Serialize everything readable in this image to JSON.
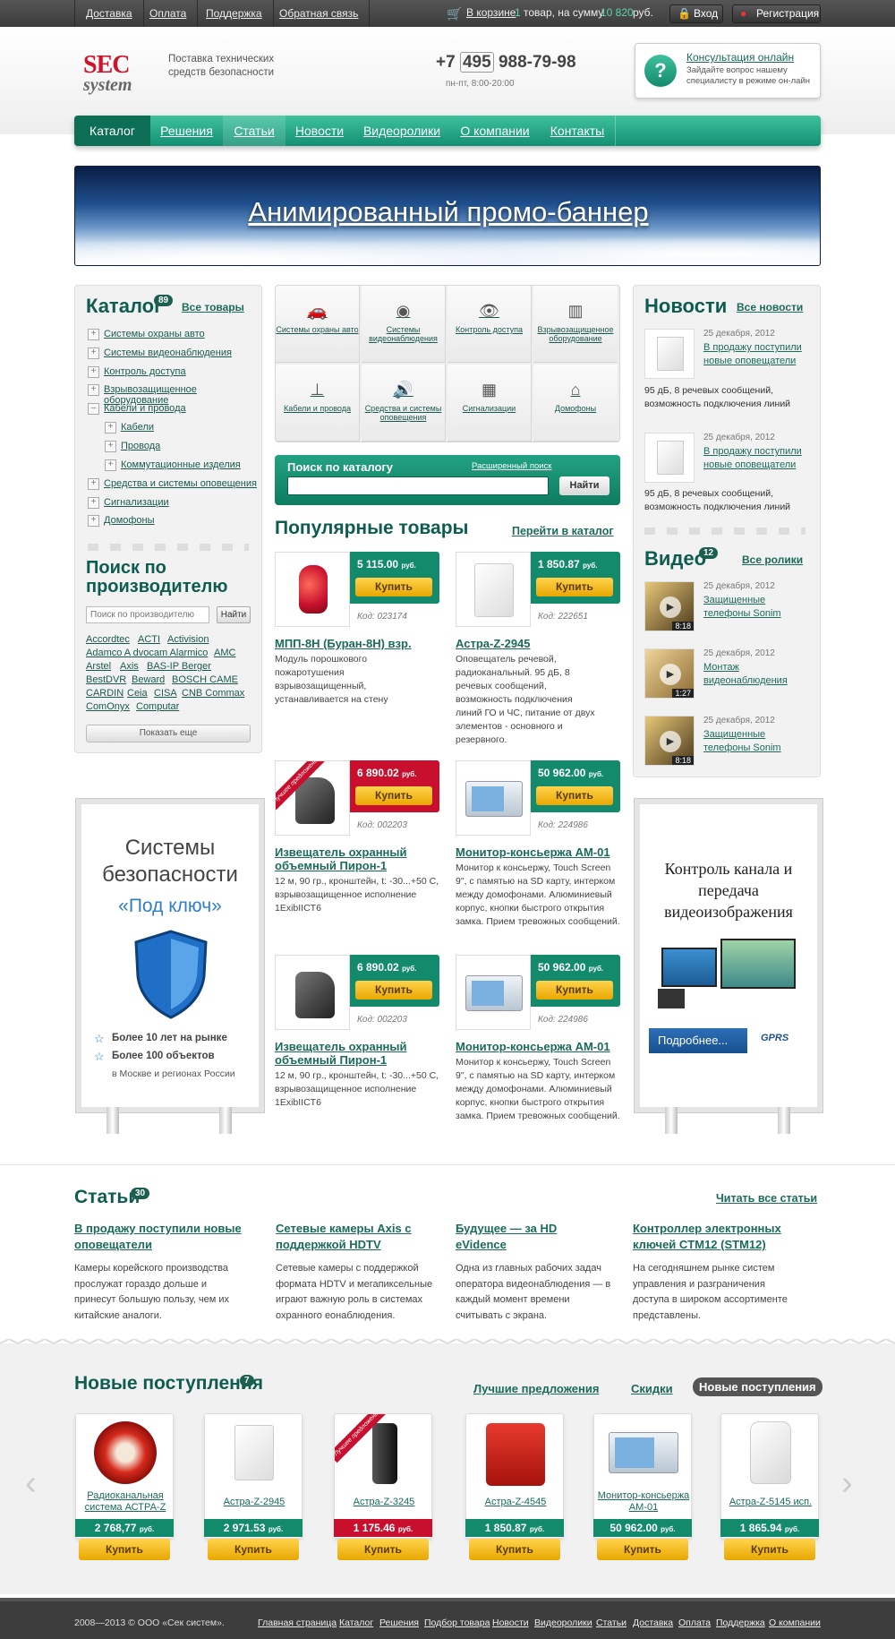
{
  "topbar": {
    "links": [
      "Доставка",
      "Оплата",
      "Поддержка",
      "Обратная связь"
    ],
    "cart_prefix": "В корзине",
    "cart_count": "1",
    "cart_mid": "товар, на сумму",
    "cart_sum": "10 820",
    "cart_currency": "руб.",
    "login": "Вход",
    "register": "Регистрация"
  },
  "header": {
    "logo_top": "SEC",
    "logo_bottom": "system",
    "tagline": "Поставка технических средств безопасности",
    "phone_prefix": "+7",
    "phone_code": "495",
    "phone_number": "988-79-98",
    "hours": "пн-пт, 8:00-20:00",
    "consult_title": "Консультация онлайн",
    "consult_text": "Зайдайте вопрос нашему специалисту в режиме он-лайн"
  },
  "nav": [
    "Каталог",
    "Решения",
    "Статьи",
    "Новости",
    "Видеоролики",
    "О компании",
    "Контакты"
  ],
  "banner": {
    "text": "Анимированный промо-баннер"
  },
  "catalog": {
    "title": "Каталог",
    "count": "89",
    "all": "Все товары",
    "items": [
      "Системы охраны авто",
      "Системы видеонаблюдения",
      "Контроль доступа",
      "Взрывозащищенное оборудование",
      "Кабели и провода",
      "Кабели",
      "Провода",
      "Коммутационные изделия",
      "Средства и системы оповещения",
      "Сигнализации",
      "Домофоны"
    ],
    "by_maker_title": "Поиск по производителю",
    "maker_placeholder": "Поиск по производителю",
    "maker_btn": "Найти",
    "brands": [
      "Accordtec",
      "ACTI",
      "Activision",
      "Adamco A dvocam Alarmico",
      "AMC",
      "Arstel",
      "Axis",
      "BAS-IP Berger",
      "BestDVR",
      "Beward",
      "BOSCH CAME",
      "CARDIN",
      "Ceia",
      "CISA",
      "CNB Commax",
      "ComOnyx",
      "Computar"
    ],
    "show_more": "Показать еще"
  },
  "categories": [
    "Системы охраны авто",
    "Системы видеонаблюдения",
    "Контроль доступа",
    "Взрывозащищенное оборудование",
    "Кабели и провода",
    "Средства и системы оповещения",
    "Сигнализации",
    "Домофоны"
  ],
  "search": {
    "title": "Поиск по каталогу",
    "advanced": "Расширенный поиск",
    "btn": "Найти"
  },
  "popular": {
    "title": "Популярные товары",
    "link": "Перейти в каталог",
    "products": [
      {
        "price": "5 115.00",
        "cur": "руб.",
        "buy": "Купить",
        "code": "Код: 023174",
        "name": "МПП-8Н (Буран-8Н) взр.",
        "desc": "Модуль порошкового пожаротушения взрывозащищенный, устанавливается на стену"
      },
      {
        "price": "1 850.87",
        "cur": "руб.",
        "buy": "Купить",
        "code": "Код: 222651",
        "name": "Астра-Z-2945",
        "desc": "Оповещатель речевой, радиоканальный. 95 дБ, 8 речевых сообщений, возможность подключения линий ГО и ЧС, питание от двух элементов - основного и резервного."
      },
      {
        "price": "6 890.02",
        "cur": "руб.",
        "buy": "Купить",
        "code": "Код: 002203",
        "name": "Извещатель охранный объемный Пирон-1",
        "desc": "12 м, 90 гр., кронштейн, t: -30...+50 С, взрывозащищенное исполнение 1ExibIICT6",
        "ribbon": "Лучшее предложение"
      },
      {
        "price": "50 962.00",
        "cur": "руб.",
        "buy": "Купить",
        "code": "Код: 224986",
        "name": "Монитор-консьержа АМ-01",
        "desc": "Монитор к консьержу, Touch Screen 9\", с памятью на SD карту, интерком между домофонами. Алюминиевый корпус, кнопки быстрого открытия замка. Прием тревожных сообщений."
      },
      {
        "price": "6 890.02",
        "cur": "руб.",
        "buy": "Купить",
        "code": "Код: 002203",
        "name": "Извещатель охранный объемный Пирон-1",
        "desc": "12 м, 90 гр., кронштейн, t: -30...+50 С, взрывозащищенное исполнение 1ExibIICT6"
      },
      {
        "price": "50 962.00",
        "cur": "руб.",
        "buy": "Купить",
        "code": "Код: 224986",
        "name": "Монитор-консьержа АМ-01",
        "desc": "Монитор к консьержу, Touch Screen 9\", с памятью на SD карту, интерком между домофонами. Алюминиевый корпус, кнопки быстрого открытия замка. Прием тревожных сообщений."
      }
    ]
  },
  "news": {
    "title": "Новости",
    "all": "Все новости",
    "items": [
      {
        "date": "25 декабря, 2012",
        "title": "В продажу поступили новые оповещатели",
        "text": "95 дБ, 8 речевых сообщений, возможность подключения линий"
      },
      {
        "date": "25 декабря, 2012",
        "title": "В продажу поступили новые оповещатели",
        "text": "95 дБ, 8 речевых сообщений, возможность подключения линий"
      }
    ]
  },
  "video": {
    "title": "Видео",
    "count": "12",
    "all": "Все ролики",
    "items": [
      {
        "date": "25 декабря, 2012",
        "title": "Защищенные телефоны Sonim",
        "dur": "8:18"
      },
      {
        "date": "25 декабря, 2012",
        "title": "Монтаж видеонаблюдения",
        "dur": "1:27"
      },
      {
        "date": "25 декабря, 2012",
        "title": "Защищенные телефоны Sonim",
        "dur": "8:18"
      }
    ]
  },
  "ad_left": {
    "title": "Системы безопасности",
    "sub": "«Под ключ»",
    "b1": "Более 10 лет на рынке",
    "b2": "Более 100 объектов",
    "b3": "в Москве и регионах России"
  },
  "ad_right": {
    "title": "Контроль канала и передача видеоизображения",
    "btn": "Подробнее...",
    "gprs": "GPRS"
  },
  "articles": {
    "title": "Статьи",
    "count": "30",
    "all": "Читать все статьи",
    "items": [
      {
        "title": "В продажу поступили новые оповещатели",
        "text": "Камеры корейского производства прослужат гораздо дольше и принесут большую пользу, чем их китайские аналоги."
      },
      {
        "title": "Сетевые камеры Axis с поддержкой HDTV",
        "text": "Сетевые камеры с поддержкой формата HDTV и мегапиксельные играют важную роль в системах охранного еонаблюдения."
      },
      {
        "title": "Будущее — за HD eVidence",
        "text": "Одна из главных рабочих задач оператора видеонаблюдения — в каждый момент времени считывать с экрана."
      },
      {
        "title": "Контроллер электронных ключей CTM12 (STM12)",
        "text": "На сегодняшнем рынке систем управления и разграничения доступа в широком ассортименте представлены."
      }
    ]
  },
  "newarrivals": {
    "title": "Новые поступления",
    "count": "7",
    "tabs": [
      "Лучшие предложения",
      "Скидки",
      "Новые поступления"
    ],
    "items": [
      {
        "name": "Радиоканальная система АСТРА-Z",
        "price": "2 768,77",
        "cur": "руб.",
        "buy": "Купить"
      },
      {
        "name": "Астра-Z-2945",
        "price": "2 971.53",
        "cur": "руб.",
        "buy": "Купить"
      },
      {
        "name": "Астра-Z-3245",
        "price": "1 175.46",
        "cur": "руб.",
        "buy": "Купить",
        "ribbon": "Лучшее предложение"
      },
      {
        "name": "Астра-Z-4545",
        "price": "1 850.87",
        "cur": "руб.",
        "buy": "Купить"
      },
      {
        "name": "Монитор-консьержа АМ-01",
        "price": "50 962.00",
        "cur": "руб.",
        "buy": "Купить"
      },
      {
        "name": "Астра-Z-5145 исп.",
        "price": "1 865.94",
        "cur": "руб.",
        "buy": "Купить"
      }
    ]
  },
  "footer": {
    "copy": "2008—2013 © ООО «Сек систем».",
    "links": [
      "Главная страница",
      "Каталог",
      "Решения",
      "Подбор товара",
      "Новости",
      "Видеоролики",
      "Статьи",
      "Доставка",
      "Оплата",
      "Поддержка",
      "О компании"
    ]
  },
  "colors": {
    "brand_green": "#138a6c",
    "dark_green": "#0d5c4f",
    "red": "#c8102e",
    "yellow": "#f2b705"
  }
}
